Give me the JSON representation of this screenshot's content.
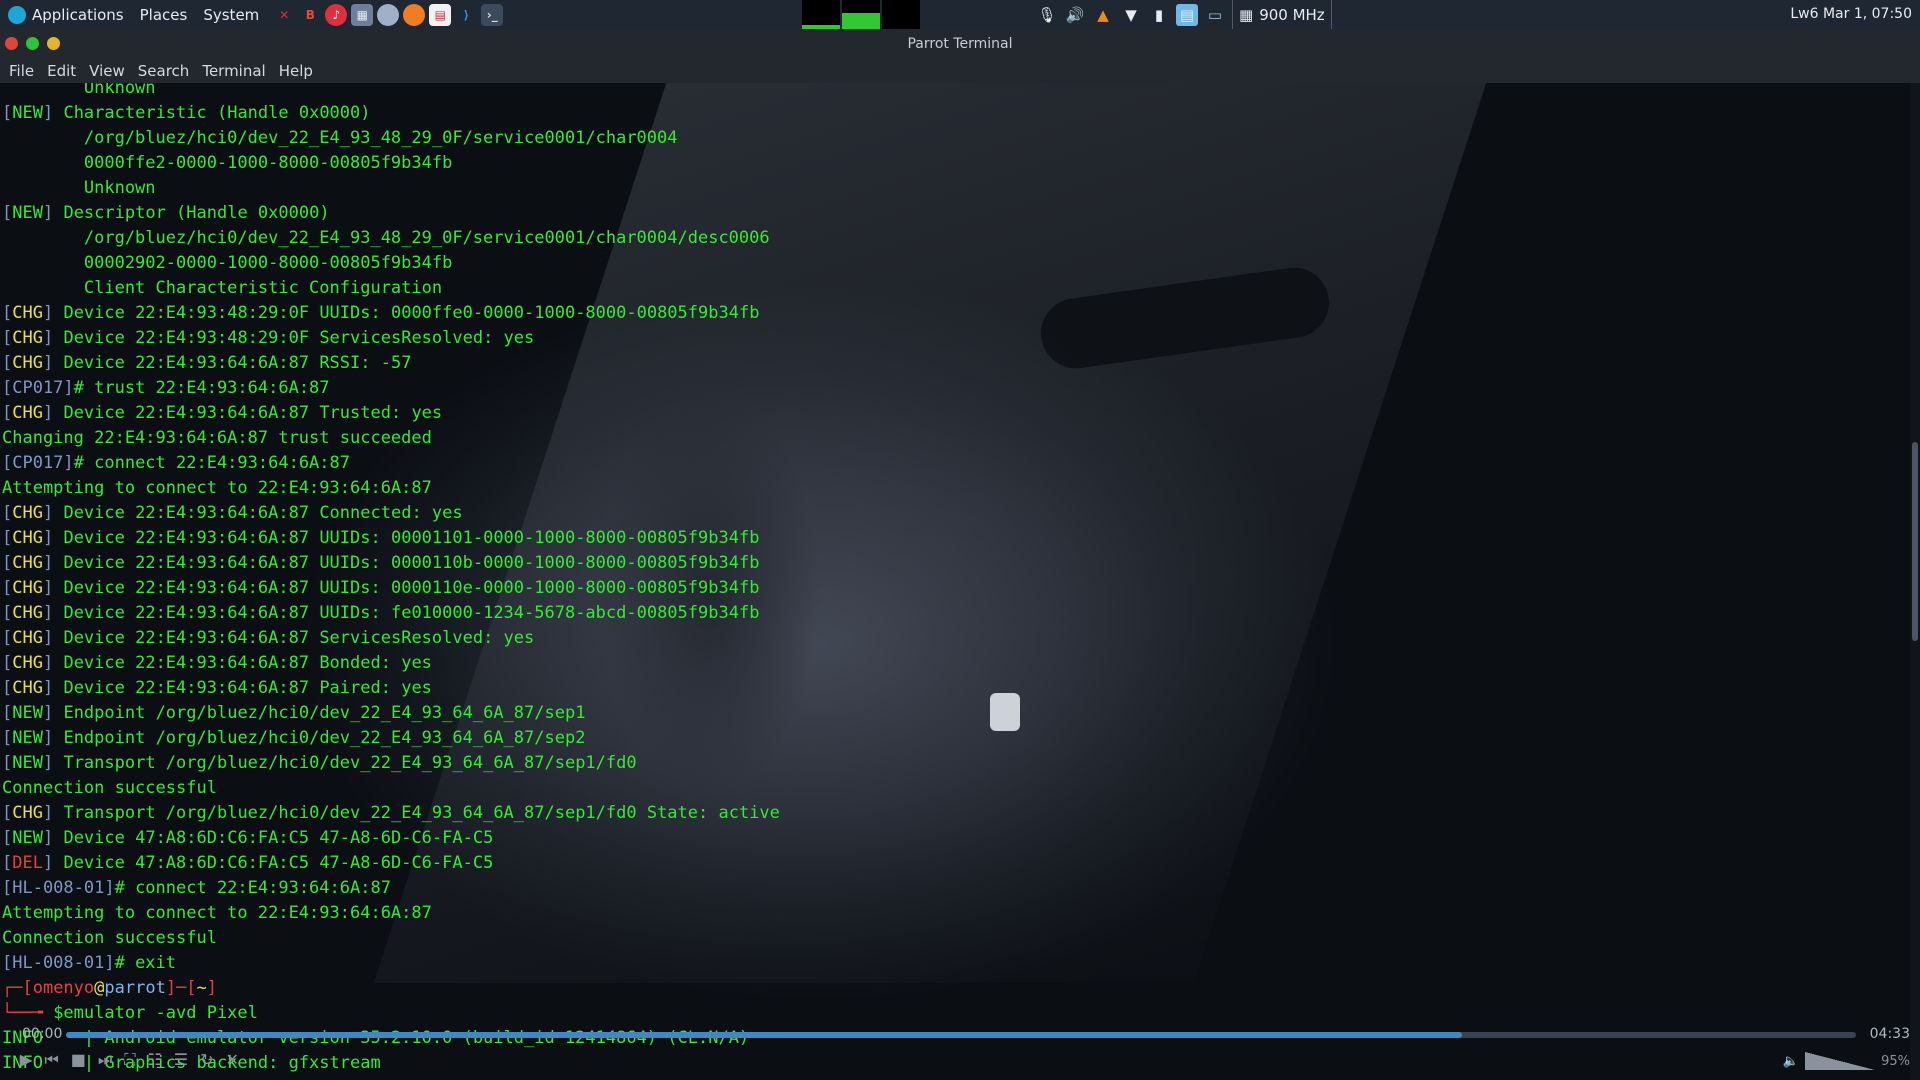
{
  "panel": {
    "menus": [
      "Applications",
      "Places",
      "System"
    ],
    "cpu_freq": "900 MHz",
    "clock": "Lw6 Mar 1, 07:50",
    "graph_levels": [
      0.15,
      0.55,
      0.0
    ]
  },
  "window": {
    "title": "Parrot Terminal",
    "menu": [
      "File",
      "Edit",
      "View",
      "Search",
      "Terminal",
      "Help"
    ]
  },
  "terminal": {
    "lines": [
      {
        "tag": "",
        "text": "        Unknown"
      },
      {
        "tag": "NEW",
        "text": " Characteristic (Handle 0x0000)"
      },
      {
        "tag": "",
        "text": "        /org/bluez/hci0/dev_22_E4_93_48_29_0F/service0001/char0004"
      },
      {
        "tag": "",
        "text": "        0000ffe2-0000-1000-8000-00805f9b34fb"
      },
      {
        "tag": "",
        "text": "        Unknown"
      },
      {
        "tag": "NEW",
        "text": " Descriptor (Handle 0x0000)"
      },
      {
        "tag": "",
        "text": "        /org/bluez/hci0/dev_22_E4_93_48_29_0F/service0001/char0004/desc0006"
      },
      {
        "tag": "",
        "text": "        00002902-0000-1000-8000-00805f9b34fb"
      },
      {
        "tag": "",
        "text": "        Client Characteristic Configuration"
      },
      {
        "tag": "CHG",
        "text": " Device 22:E4:93:48:29:0F UUIDs: 0000ffe0-0000-1000-8000-00805f9b34fb"
      },
      {
        "tag": "CHG",
        "text": " Device 22:E4:93:48:29:0F ServicesResolved: yes"
      },
      {
        "tag": "CHG",
        "text": " Device 22:E4:93:64:6A:87 RSSI: -57"
      },
      {
        "tag": "PROMPT:CP017",
        "text": "# trust 22:E4:93:64:6A:87"
      },
      {
        "tag": "CHG",
        "text": " Device 22:E4:93:64:6A:87 Trusted: yes"
      },
      {
        "tag": "",
        "text": "Changing 22:E4:93:64:6A:87 trust succeeded"
      },
      {
        "tag": "PROMPT:CP017",
        "text": "# connect 22:E4:93:64:6A:87"
      },
      {
        "tag": "",
        "text": "Attempting to connect to 22:E4:93:64:6A:87"
      },
      {
        "tag": "CHG",
        "text": " Device 22:E4:93:64:6A:87 Connected: yes"
      },
      {
        "tag": "CHG",
        "text": " Device 22:E4:93:64:6A:87 UUIDs: 00001101-0000-1000-8000-00805f9b34fb"
      },
      {
        "tag": "CHG",
        "text": " Device 22:E4:93:64:6A:87 UUIDs: 0000110b-0000-1000-8000-00805f9b34fb"
      },
      {
        "tag": "CHG",
        "text": " Device 22:E4:93:64:6A:87 UUIDs: 0000110e-0000-1000-8000-00805f9b34fb"
      },
      {
        "tag": "CHG",
        "text": " Device 22:E4:93:64:6A:87 UUIDs: fe010000-1234-5678-abcd-00805f9b34fb"
      },
      {
        "tag": "CHG",
        "text": " Device 22:E4:93:64:6A:87 ServicesResolved: yes"
      },
      {
        "tag": "CHG",
        "text": " Device 22:E4:93:64:6A:87 Bonded: yes"
      },
      {
        "tag": "CHG",
        "text": " Device 22:E4:93:64:6A:87 Paired: yes"
      },
      {
        "tag": "NEW",
        "text": " Endpoint /org/bluez/hci0/dev_22_E4_93_64_6A_87/sep1"
      },
      {
        "tag": "NEW",
        "text": " Endpoint /org/bluez/hci0/dev_22_E4_93_64_6A_87/sep2"
      },
      {
        "tag": "NEW",
        "text": " Transport /org/bluez/hci0/dev_22_E4_93_64_6A_87/sep1/fd0"
      },
      {
        "tag": "",
        "text": "Connection successful"
      },
      {
        "tag": "CHG",
        "text": " Transport /org/bluez/hci0/dev_22_E4_93_64_6A_87/sep1/fd0 State: active"
      },
      {
        "tag": "NEW",
        "text": " Device 47:A8:6D:C6:FA:C5 47-A8-6D-C6-FA-C5"
      },
      {
        "tag": "DEL",
        "text": " Device 47:A8:6D:C6:FA:C5 47-A8-6D-C6-FA-C5"
      },
      {
        "tag": "PROMPT:HL-008-01",
        "text": "# connect 22:E4:93:64:6A:87"
      },
      {
        "tag": "",
        "text": "Attempting to connect to 22:E4:93:64:6A:87"
      },
      {
        "tag": "",
        "text": "Connection successful"
      },
      {
        "tag": "PROMPT:HL-008-01",
        "text": "# exit"
      },
      {
        "tag": "SHELL1",
        "text": ""
      },
      {
        "tag": "SHELL2",
        "text": "$emulator -avd Pixel"
      },
      {
        "tag": "INFO",
        "text": "    | Android emulator version 35.2.10.0 (build_id 12414864) (CL:N/A)"
      },
      {
        "tag": "INFO",
        "text": "    | Graphics backend: gfxstream"
      }
    ],
    "shell_user": "omenyo",
    "shell_at": "@",
    "shell_host": "parrot",
    "shell_dir": "~"
  },
  "media": {
    "elapsed": "00:00",
    "total": "04:33",
    "progress": 0.78,
    "volume_label": "95%"
  },
  "scrollbar": {
    "position": 0.36,
    "size": 0.2
  }
}
